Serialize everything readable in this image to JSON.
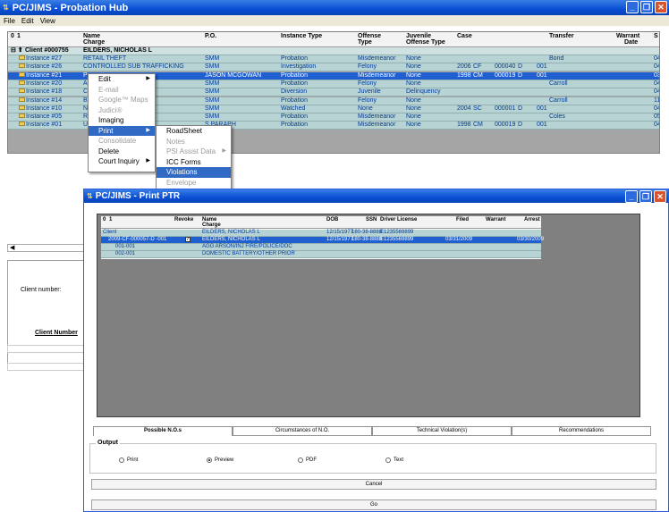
{
  "main_window": {
    "title": "PC/JIMS - Probation Hub",
    "menu": [
      "File",
      "Edit",
      "View"
    ]
  },
  "grid": {
    "columns": [
      "0",
      "1",
      "Name",
      "Charge",
      "P.O.",
      "Instance Type",
      "Offense",
      "Type",
      "Juvenile",
      "Offense Type",
      "Case",
      "Transfer",
      "Warrant",
      "Date",
      "S"
    ],
    "client": {
      "label": "Client #000755",
      "name": "EILDERS, NICHOLAS L"
    },
    "rows": [
      {
        "label": "Instance #27",
        "charge": "RETAIL THEFT",
        "po": "SMM",
        "type": "Probation",
        "offense": "Misdemeanor",
        "juv": "None",
        "year": "",
        "court": "",
        "num": "",
        "div": "",
        "seq": "",
        "transfer": "Bond",
        "s": "04"
      },
      {
        "label": "Instance #26",
        "charge": "CONTROLLED SUB TRAFFICKING",
        "po": "SMM",
        "type": "Investigation",
        "offense": "Felony",
        "juv": "None",
        "year": "2006",
        "court": "CF",
        "num": "000040",
        "div": "D",
        "seq": "001",
        "transfer": "",
        "s": "04"
      },
      {
        "label": "Instance #21",
        "charge": "P",
        "po": "JASON MCGOWAN",
        "type": "Probation",
        "offense": "Misdemeanor",
        "juv": "None",
        "year": "1998",
        "court": "CM",
        "num": "000019",
        "div": "D",
        "seq": "001",
        "transfer": "",
        "s": "03"
      },
      {
        "label": "Instance #20",
        "charge": "AC",
        "po": "SMM",
        "type": "Probation",
        "offense": "Felony",
        "juv": "None",
        "year": "",
        "court": "",
        "num": "",
        "div": "",
        "seq": "",
        "transfer": "Carroll",
        "s": "04"
      },
      {
        "label": "Instance #18",
        "charge": "CI",
        "po": "SMM",
        "type": "Diversion",
        "offense": "Juvenile",
        "juv": "Delinquency",
        "year": "",
        "court": "",
        "num": "",
        "div": "",
        "seq": "",
        "transfer": "",
        "s": "04"
      },
      {
        "label": "Instance #14",
        "charge": "BI",
        "po": "SMM",
        "type": "Probation",
        "offense": "Felony",
        "juv": "None",
        "year": "",
        "court": "",
        "num": "",
        "div": "",
        "seq": "",
        "transfer": "Carroll",
        "s": "11"
      },
      {
        "label": "Instance #10",
        "charge": "NI",
        "po": "SMM",
        "type": "Watched",
        "offense": "None",
        "juv": "None",
        "year": "2004",
        "court": "SC",
        "num": "000001",
        "div": "D",
        "seq": "001",
        "transfer": "",
        "s": "04"
      },
      {
        "label": "Instance #05",
        "charge": "RI",
        "po": "SMM",
        "type": "Probation",
        "offense": "Misdemeanor",
        "juv": "None",
        "year": "",
        "court": "",
        "num": "",
        "div": "",
        "seq": "",
        "transfer": "Coles",
        "s": "05"
      },
      {
        "label": "Instance #01",
        "charge": "UI",
        "po": "S PARAPH",
        "type": "Probation",
        "offense": "Misdemeanor",
        "juv": "None",
        "year": "1998",
        "court": "CM",
        "num": "000019",
        "div": "D",
        "seq": "001",
        "transfer": "",
        "s": "04"
      }
    ]
  },
  "context_menu": {
    "items": [
      "Edit",
      "E-mail",
      "Google™ Maps",
      "Judici®",
      "Imaging",
      "Print",
      "Consolidate",
      "Delete",
      "Court Inquiry"
    ],
    "submenu": [
      "RoadSheet",
      "Notes",
      "PSI Assist Data",
      "ICC Forms",
      "Violations",
      "Envelope"
    ]
  },
  "left_panel": {
    "client_number_label": "Client number:",
    "client_number_header": "Client Number"
  },
  "print_window": {
    "title": "PC/JIMS - Print PTR",
    "columns": [
      "0",
      "1",
      "Revoke",
      "Name",
      "Charge",
      "DOB",
      "SSN",
      "Driver License",
      "Filed",
      "Warrant",
      "Arrest"
    ],
    "rows": [
      {
        "label": "Client",
        "name": "EILDERS, NICHOLAS L",
        "dob": "12/15/1977",
        "ssn": "180-38-8888",
        "dl": "E1235569899",
        "filed": "",
        "arrest": ""
      },
      {
        "label": "2009-CF-000057-D -001",
        "name": "EILDERS, NICHOLAS L",
        "dob": "12/15/1977",
        "ssn": "180-38-8888",
        "dl": "E1235569899",
        "filed": "03/31/2009",
        "arrest": "03/30/2009"
      },
      {
        "label": "001-001",
        "name": "AGG ARSON/INJ FIRE/POLICE/DOC",
        "dob": "",
        "ssn": "",
        "dl": "",
        "filed": "",
        "arrest": ""
      },
      {
        "label": "002-001",
        "name": "DOMESTIC BATTERY/OTHER PRIOR",
        "dob": "",
        "ssn": "",
        "dl": "",
        "filed": "",
        "arrest": ""
      }
    ],
    "tabs": [
      "Possible N.O.s",
      "Circumstances of N.O.",
      "Technical Violation(s)",
      "Recommendations"
    ],
    "output_label": "Output",
    "radios": [
      "Print",
      "Preview",
      "PDF",
      "Text"
    ],
    "cancel_label": "Cancel",
    "go_label": "Go"
  }
}
